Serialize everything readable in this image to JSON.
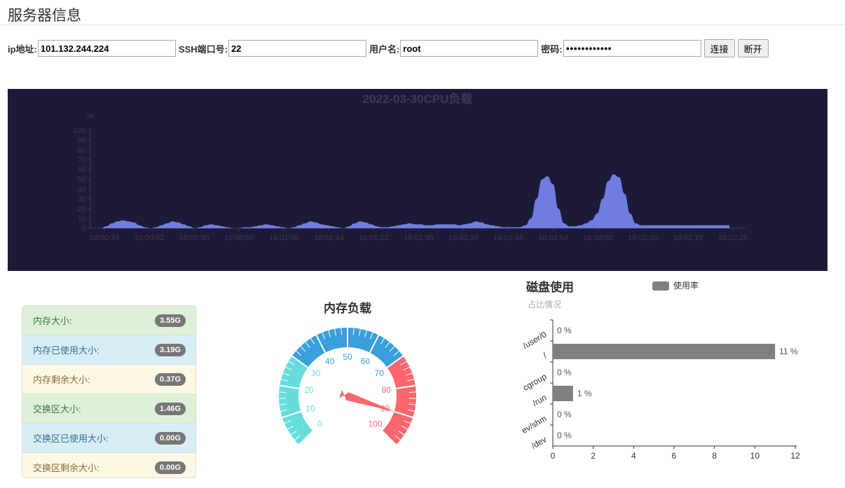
{
  "page": {
    "title": "服务器信息"
  },
  "connection": {
    "ip_label": "ip地址:",
    "ip_value": "101.132.244.224",
    "port_label": "SSH端口号:",
    "port_value": "22",
    "user_label": "用户名:",
    "user_value": "root",
    "password_label": "密码:",
    "password_value": "●●●●●●●●●●●●",
    "connect_label": "连接",
    "disconnect_label": "断开"
  },
  "cpu_chart": {
    "type": "area",
    "title": "2022-03-30CPU负载",
    "ylabel": "%",
    "ylim": [
      0,
      100
    ],
    "yticks": [
      0,
      10,
      20,
      30,
      40,
      50,
      60,
      70,
      80,
      90,
      100
    ],
    "xticks": [
      "16:00:34",
      "16:00:42",
      "16:00:50",
      "16:00:58",
      "16:01:06",
      "16:01:14",
      "16:01:22",
      "16:01:30",
      "16:01:38",
      "16:01:46",
      "16:01:54",
      "16:02:02",
      "16:02:10",
      "16:02:18",
      "16:02:26"
    ],
    "x": [
      0,
      1,
      2,
      3,
      4,
      5,
      6,
      7,
      8,
      9,
      10,
      11,
      12,
      13,
      14,
      15,
      16,
      17,
      18,
      19,
      20,
      21,
      22,
      23,
      24,
      25,
      26,
      27,
      28,
      29,
      30,
      31,
      32,
      33,
      34,
      35,
      36,
      37,
      38,
      39,
      40,
      41,
      42,
      43,
      44,
      45,
      46,
      47,
      48,
      49,
      50,
      51,
      52,
      53,
      54,
      55,
      56,
      57,
      58,
      59,
      60,
      61,
      62,
      63,
      64,
      65,
      66,
      67,
      68,
      69,
      70,
      71,
      72,
      73,
      74,
      75,
      76,
      77,
      78,
      79,
      80,
      81,
      82,
      83,
      84,
      85,
      86,
      87,
      88,
      89,
      90,
      91,
      92,
      93,
      94,
      95,
      96,
      97,
      98,
      99,
      100,
      101,
      102,
      103,
      104,
      105,
      106,
      107,
      108,
      109,
      110,
      111,
      112,
      113,
      114
    ],
    "series": [
      {
        "values": [
          0,
          2,
          5,
          7,
          8,
          7,
          6,
          3,
          1,
          0,
          1,
          3,
          5,
          7,
          6,
          4,
          2,
          0,
          1,
          3,
          4,
          3,
          2,
          1,
          0,
          0,
          1,
          1,
          2,
          3,
          4,
          3,
          2,
          1,
          0,
          1,
          3,
          5,
          7,
          6,
          4,
          3,
          2,
          1,
          0,
          2,
          5,
          7,
          6,
          4,
          2,
          1,
          1,
          2,
          3,
          4,
          5,
          4,
          4,
          3,
          3,
          4,
          4,
          4,
          4,
          3,
          4,
          5,
          7,
          6,
          4,
          3,
          2,
          1,
          1,
          1,
          1,
          3,
          10,
          30,
          50,
          53,
          45,
          20,
          5,
          2,
          2,
          3,
          5,
          8,
          15,
          30,
          48,
          55,
          52,
          35,
          15,
          5,
          3,
          3,
          3,
          3,
          3,
          3,
          3,
          3,
          3,
          3,
          3,
          3,
          3,
          3,
          3,
          3,
          3
        ]
      }
    ],
    "color": "#6f7de0"
  },
  "memory": {
    "rows": [
      {
        "label": "内存大小:",
        "value": "3.55G"
      },
      {
        "label": "内存已使用大小:",
        "value": "3.19G"
      },
      {
        "label": "内存剩余大小:",
        "value": "0.37G"
      },
      {
        "label": "交换区大小:",
        "value": "1.46G"
      },
      {
        "label": "交换区已使用大小:",
        "value": "0.00G"
      },
      {
        "label": "交换区剩余大小:",
        "value": "0.00G"
      }
    ]
  },
  "memory_gauge": {
    "title": "内存负载",
    "value": 90,
    "ticks": [
      "0",
      "10",
      "20",
      "30",
      "40",
      "50",
      "60",
      "70",
      "80",
      "90",
      "100"
    ],
    "colors": [
      "#66dddc",
      "#39a0dc",
      "#fd666d"
    ]
  },
  "disk_chart": {
    "type": "bar",
    "title": "磁盘使用",
    "subtitle": "占比情况",
    "legend": "使用率",
    "categories": [
      "/user/0",
      "/",
      "cgroup",
      "/run",
      "ev/shm",
      "/dev"
    ],
    "values": [
      0,
      11,
      0,
      1,
      0,
      0
    ],
    "value_labels": [
      "0 %",
      "11 %",
      "0 %",
      "1 %",
      "0 %",
      "0 %"
    ],
    "xlim": [
      0,
      12
    ],
    "xticks": [
      "0",
      "2",
      "4",
      "6",
      "8",
      "10",
      "12"
    ],
    "color": "#808080"
  }
}
